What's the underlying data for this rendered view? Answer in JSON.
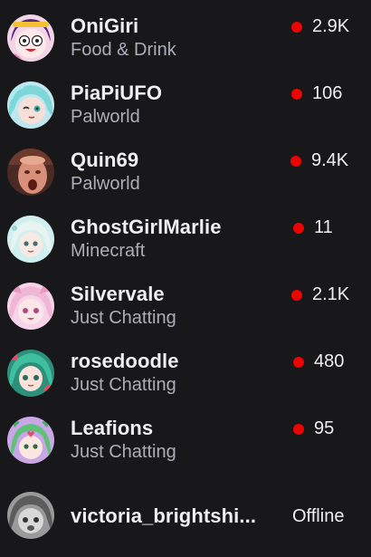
{
  "channels": [
    {
      "name": "OniGiri",
      "category": "Food & Drink",
      "viewers": "2.9K",
      "status_color": "#eb0400",
      "avatar_icon": "onigiri-avatar"
    },
    {
      "name": "PiaPiUFO",
      "category": "Palworld",
      "viewers": "106",
      "status_color": "#eb0400",
      "avatar_icon": "piapiufo-avatar"
    },
    {
      "name": "Quin69",
      "category": "Palworld",
      "viewers": "9.4K",
      "status_color": "#eb0400",
      "avatar_icon": "quin69-avatar"
    },
    {
      "name": "GhostGirlMarlie",
      "category": "Minecraft",
      "viewers": "11",
      "status_color": "#eb0400",
      "avatar_icon": "ghostgirlmarlie-avatar"
    },
    {
      "name": "Silvervale",
      "category": "Just Chatting",
      "viewers": "2.1K",
      "status_color": "#eb0400",
      "avatar_icon": "silvervale-avatar"
    },
    {
      "name": "rosedoodle",
      "category": "Just Chatting",
      "viewers": "480",
      "status_color": "#eb0400",
      "avatar_icon": "rosedoodle-avatar"
    },
    {
      "name": "Leafions",
      "category": "Just Chatting",
      "viewers": "95",
      "status_color": "#eb0400",
      "avatar_icon": "leafions-avatar"
    },
    {
      "name": "victoria_brightshi...",
      "status": "Offline",
      "avatar_icon": "victoria-avatar"
    }
  ]
}
